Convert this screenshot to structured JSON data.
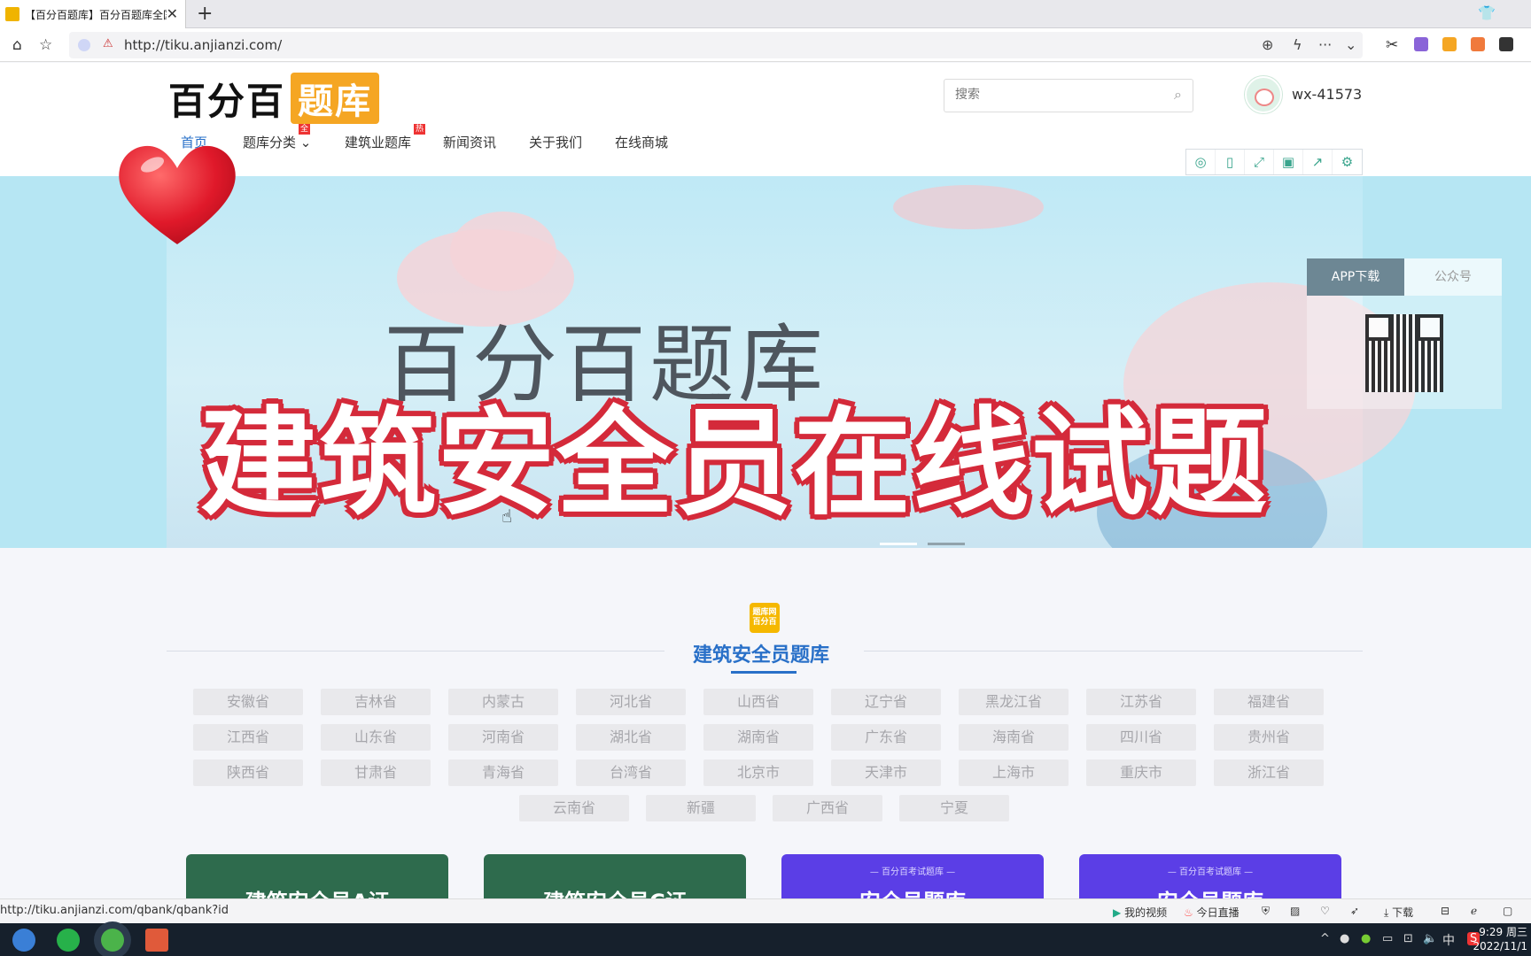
{
  "browser": {
    "tab_title": "【百分百题库】百分百题库全国",
    "url": "http://tiku.anjianzi.com/",
    "status_url": "http://tiku.anjianzi.com/qbank/qbank?id"
  },
  "header": {
    "logo_part1": "百分百",
    "logo_part2": "题库",
    "search_placeholder": "搜索",
    "username": "wx-41573"
  },
  "nav": {
    "items": [
      {
        "label": "首页"
      },
      {
        "label": "题库分类",
        "badge": "全"
      },
      {
        "label": "建筑业题库",
        "badge": "热"
      },
      {
        "label": "新闻资讯"
      },
      {
        "label": "关于我们"
      },
      {
        "label": "在线商城"
      }
    ]
  },
  "banner": {
    "title": "百分百题库",
    "overlay": "建筑安全员在线试题",
    "qr_tabs": [
      "APP下载",
      "公众号"
    ]
  },
  "section": {
    "icon_text": "题库网 百分百",
    "title": "建筑安全员题库",
    "provinces": [
      "安徽省",
      "吉林省",
      "内蒙古",
      "河北省",
      "山西省",
      "辽宁省",
      "黑龙江省",
      "江苏省",
      "福建省",
      "江西省",
      "山东省",
      "河南省",
      "湖北省",
      "湖南省",
      "广东省",
      "海南省",
      "四川省",
      "贵州省",
      "陕西省",
      "甘肃省",
      "青海省",
      "台湾省",
      "北京市",
      "天津市",
      "上海市",
      "重庆市",
      "浙江省",
      "云南省",
      "新疆",
      "广西省",
      "宁夏"
    ],
    "cards": [
      {
        "text": "建筑安全员A证",
        "color": "#2e6b4d",
        "sub": ""
      },
      {
        "text": "建筑安全员C证",
        "color": "#2e6b4d",
        "sub": ""
      },
      {
        "text": "安全员题库",
        "color": "#5b3ee6",
        "sub": "— 百分百考试题库 —"
      },
      {
        "text": "安全员题库",
        "color": "#5b3ee6",
        "sub": "— 百分百考试题库 —"
      }
    ]
  },
  "statusbar": {
    "items": [
      "我的视频",
      "今日直播",
      "下载"
    ]
  },
  "taskbar": {
    "ime": "中",
    "time": "9:29 周三",
    "date": "2022/11/1"
  }
}
